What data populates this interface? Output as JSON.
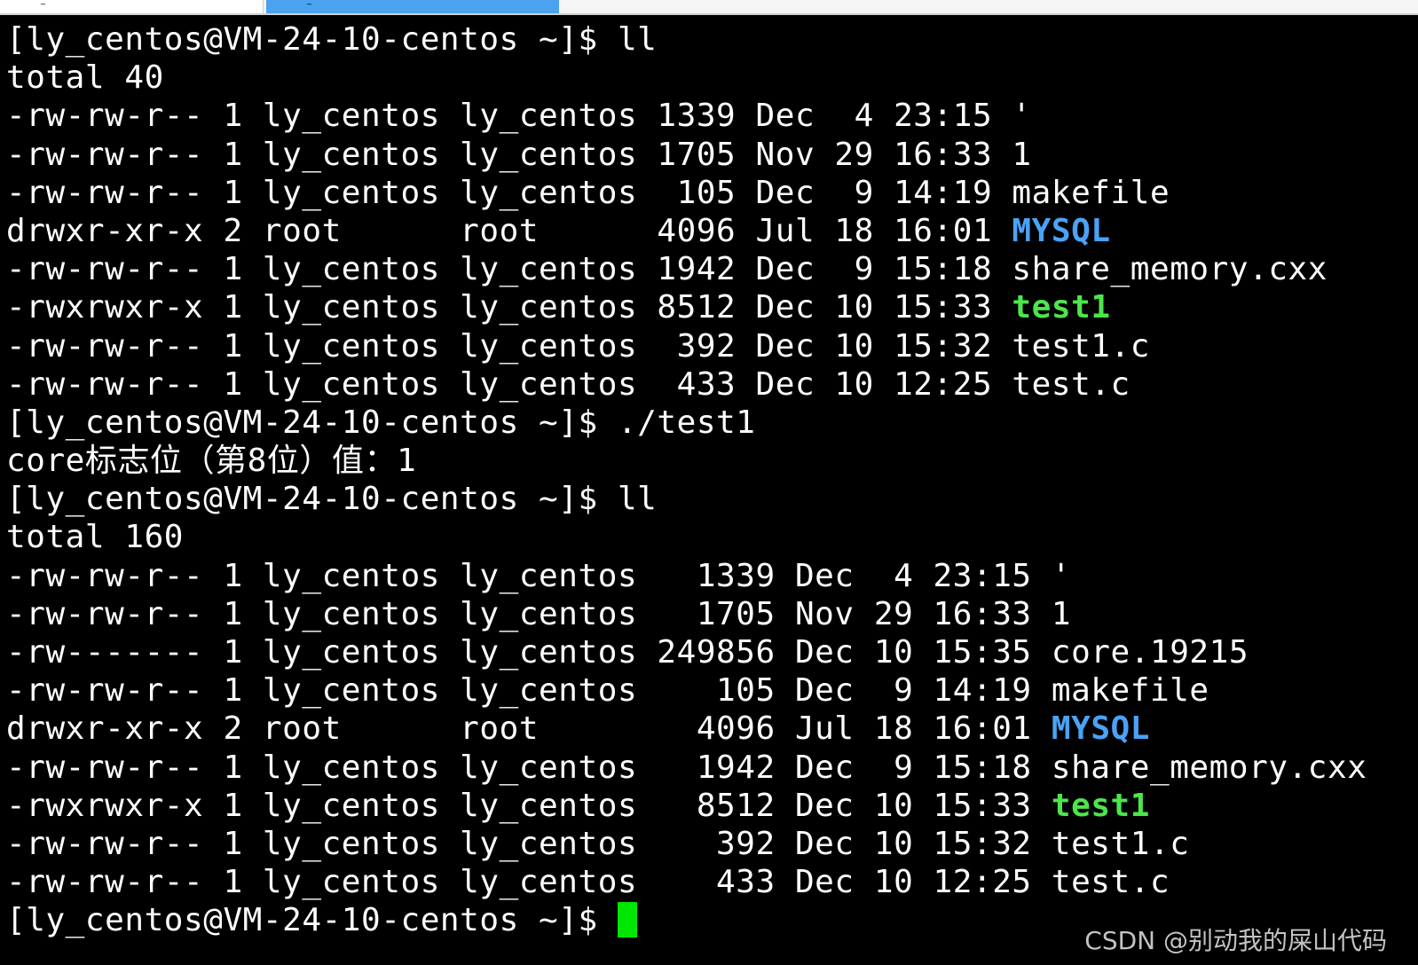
{
  "tabs": [
    {
      "label": "_",
      "active": false
    },
    {
      "label": "_",
      "active": true
    }
  ],
  "colors": {
    "background": "#000000",
    "text": "#ffffff",
    "directory": "#4aa3f6",
    "executable": "#4ce64c",
    "cursor": "#00e600",
    "tab_active": "#4ba3f0"
  },
  "terminal": {
    "lines": [
      {
        "segments": [
          {
            "text": "[ly_centos@VM-24-10-centos ~]$ ll"
          }
        ]
      },
      {
        "segments": [
          {
            "text": "total 40"
          }
        ]
      },
      {
        "segments": [
          {
            "text": "-rw-rw-r-- 1 ly_centos ly_centos 1339 Dec  4 23:15 '"
          }
        ]
      },
      {
        "segments": [
          {
            "text": "-rw-rw-r-- 1 ly_centos ly_centos 1705 Nov 29 16:33 1"
          }
        ]
      },
      {
        "segments": [
          {
            "text": "-rw-rw-r-- 1 ly_centos ly_centos  105 Dec  9 14:19 makefile"
          }
        ]
      },
      {
        "segments": [
          {
            "text": "drwxr-xr-x 2 root      root      4096 Jul 18 16:01 "
          },
          {
            "text": "MYSQL",
            "style": "dir"
          }
        ]
      },
      {
        "segments": [
          {
            "text": "-rw-rw-r-- 1 ly_centos ly_centos 1942 Dec  9 15:18 share_memory.cxx"
          }
        ]
      },
      {
        "segments": [
          {
            "text": "-rwxrwxr-x 1 ly_centos ly_centos 8512 Dec 10 15:33 "
          },
          {
            "text": "test1",
            "style": "exec"
          }
        ]
      },
      {
        "segments": [
          {
            "text": "-rw-rw-r-- 1 ly_centos ly_centos  392 Dec 10 15:32 test1.c"
          }
        ]
      },
      {
        "segments": [
          {
            "text": "-rw-rw-r-- 1 ly_centos ly_centos  433 Dec 10 12:25 test.c"
          }
        ]
      },
      {
        "segments": [
          {
            "text": "[ly_centos@VM-24-10-centos ~]$ ./test1"
          }
        ]
      },
      {
        "segments": [
          {
            "text": "core标志位（第8位）值：1"
          }
        ]
      },
      {
        "segments": [
          {
            "text": "[ly_centos@VM-24-10-centos ~]$ ll"
          }
        ]
      },
      {
        "segments": [
          {
            "text": "total 160"
          }
        ]
      },
      {
        "segments": [
          {
            "text": "-rw-rw-r-- 1 ly_centos ly_centos   1339 Dec  4 23:15 '"
          }
        ]
      },
      {
        "segments": [
          {
            "text": "-rw-rw-r-- 1 ly_centos ly_centos   1705 Nov 29 16:33 1"
          }
        ]
      },
      {
        "segments": [
          {
            "text": "-rw------- 1 ly_centos ly_centos 249856 Dec 10 15:35 core.19215"
          }
        ]
      },
      {
        "segments": [
          {
            "text": "-rw-rw-r-- 1 ly_centos ly_centos    105 Dec  9 14:19 makefile"
          }
        ]
      },
      {
        "segments": [
          {
            "text": "drwxr-xr-x 2 root      root        4096 Jul 18 16:01 "
          },
          {
            "text": "MYSQL",
            "style": "dir"
          }
        ]
      },
      {
        "segments": [
          {
            "text": "-rw-rw-r-- 1 ly_centos ly_centos   1942 Dec  9 15:18 share_memory.cxx"
          }
        ]
      },
      {
        "segments": [
          {
            "text": "-rwxrwxr-x 1 ly_centos ly_centos   8512 Dec 10 15:33 "
          },
          {
            "text": "test1",
            "style": "exec"
          }
        ]
      },
      {
        "segments": [
          {
            "text": "-rw-rw-r-- 1 ly_centos ly_centos    392 Dec 10 15:32 test1.c"
          }
        ]
      },
      {
        "segments": [
          {
            "text": "-rw-rw-r-- 1 ly_centos ly_centos    433 Dec 10 12:25 test.c"
          }
        ]
      },
      {
        "segments": [
          {
            "text": "[ly_centos@VM-24-10-centos ~]$ "
          }
        ],
        "cursor": true
      }
    ]
  },
  "watermark": "CSDN @别动我的屎山代码"
}
